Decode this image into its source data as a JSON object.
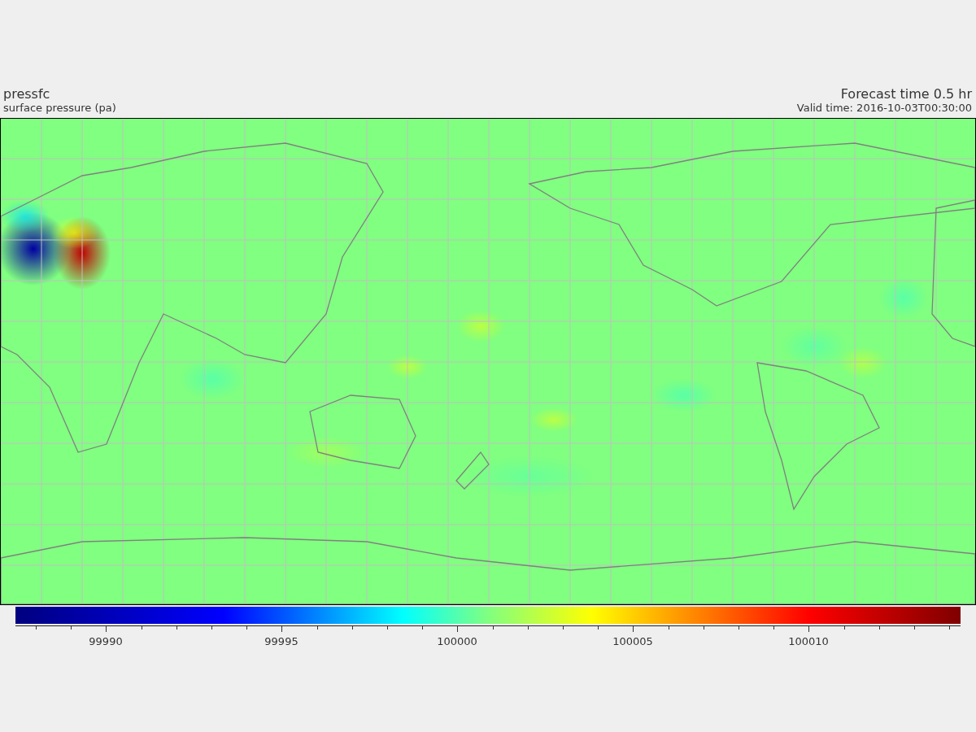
{
  "header": {
    "variable": "pressfc",
    "description": "surface pressure (pa)",
    "forecast_time": "Forecast time 0.5 hr",
    "valid_time": "Valid time: 2016-10-03T00:30:00"
  },
  "colorbar": {
    "tick_labels": [
      "99990",
      "99995",
      "100000",
      "100005",
      "100010"
    ]
  }
}
